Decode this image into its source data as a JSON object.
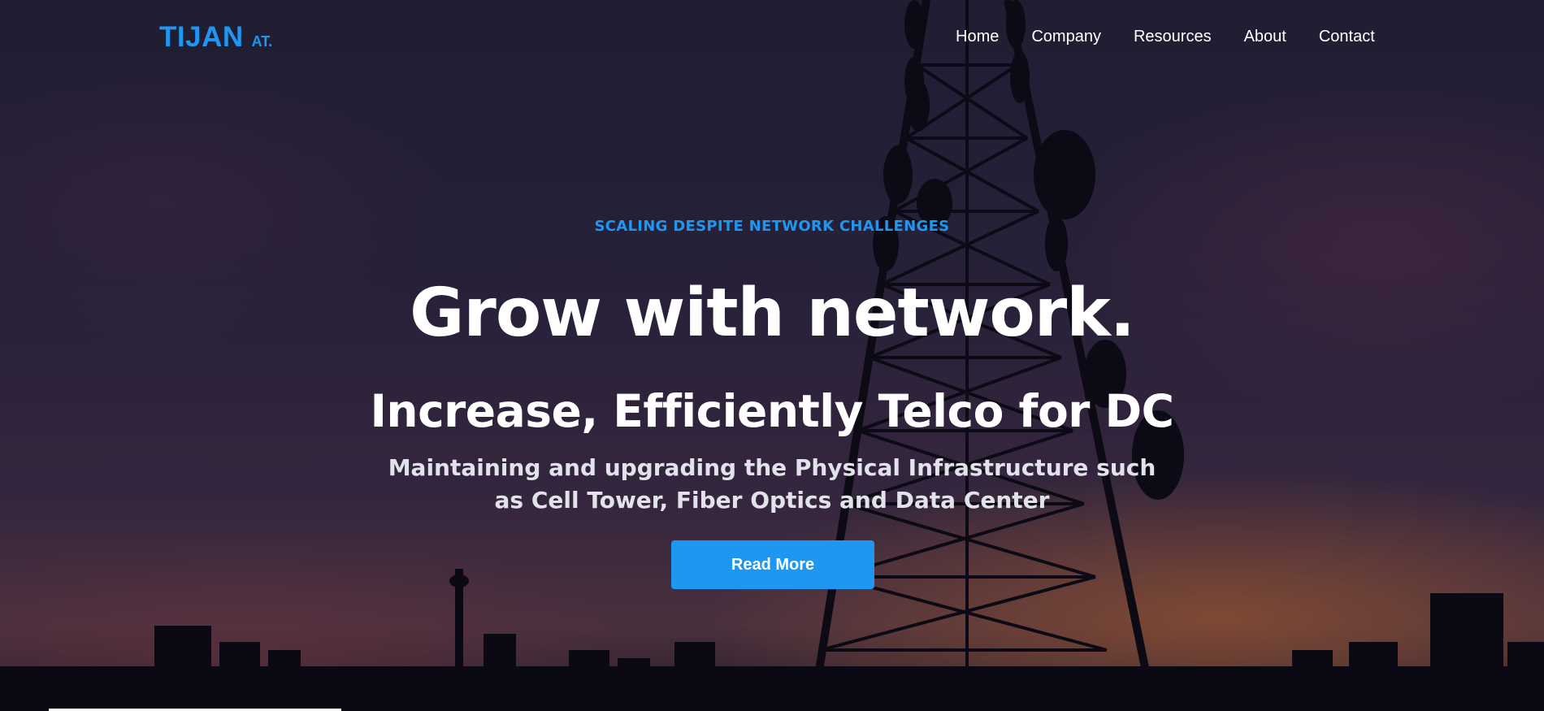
{
  "brand": {
    "name": "TIJAN",
    "suffix": "AT."
  },
  "nav": {
    "items": [
      {
        "label": "Home"
      },
      {
        "label": "Company"
      },
      {
        "label": "Resources"
      },
      {
        "label": "About"
      },
      {
        "label": "Contact"
      }
    ]
  },
  "hero": {
    "tagline": "SCALING DESPITE NETWORK CHALLENGES",
    "headline": "Grow with network.",
    "subheadline": "Increase, Efficiently Telco for DC",
    "description": "Maintaining and upgrading the Physical Infrastructure such as Cell Tower, Fiber Optics and Data Center",
    "cta_label": "Read More",
    "background_image": "telecom-tower-silhouette-at-sunset"
  },
  "colors": {
    "accent": "#1e97f0",
    "text_primary": "#ffffff",
    "text_secondary": "#e2e2ea"
  }
}
